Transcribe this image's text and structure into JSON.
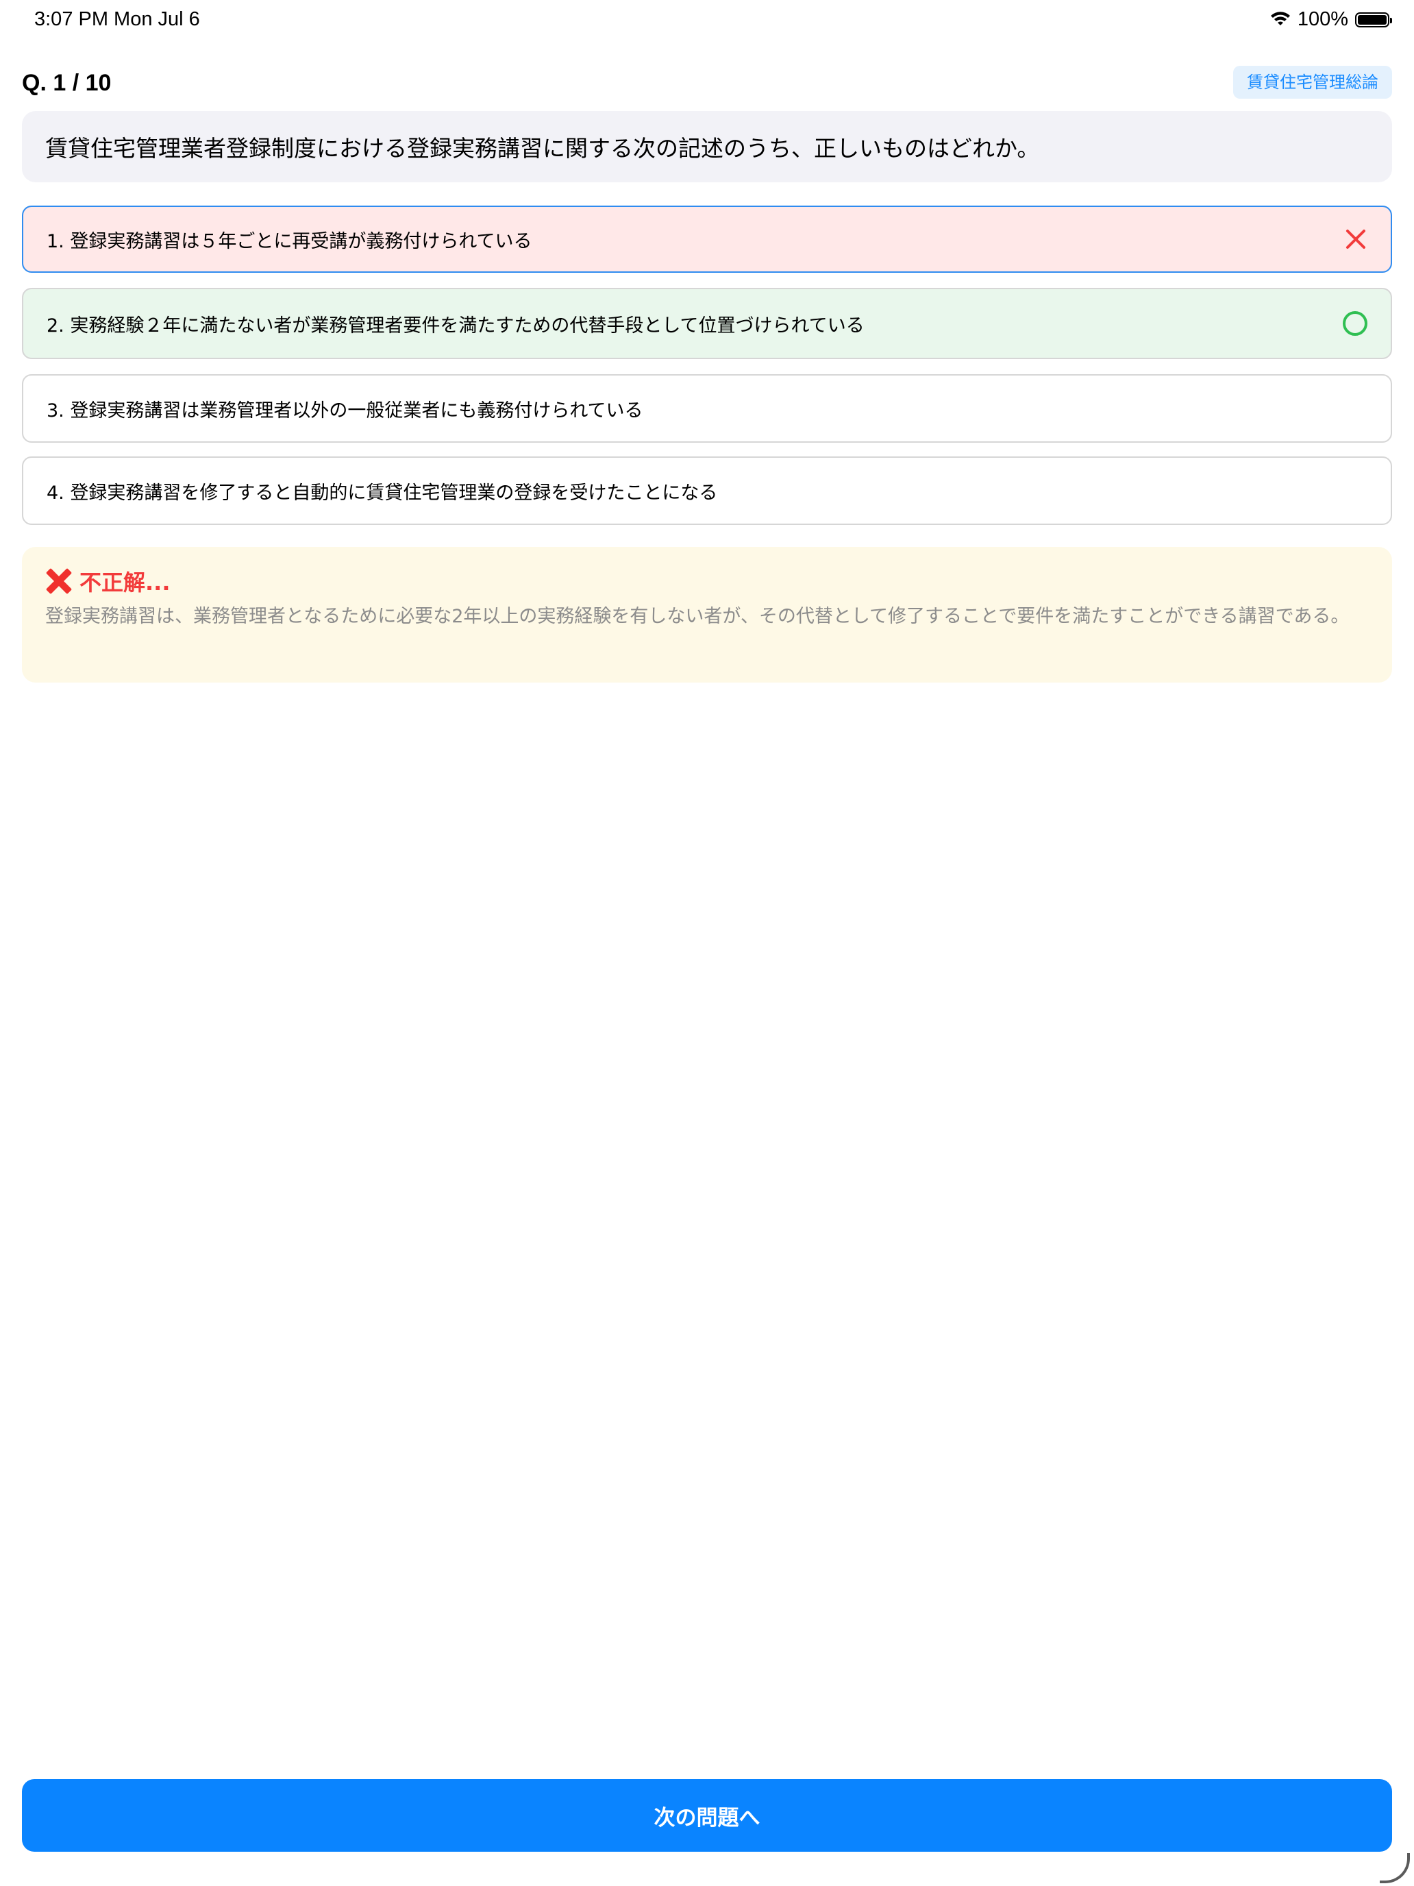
{
  "status_bar": {
    "time_date": "3:07 PM   Mon Jul 6",
    "battery_percent": "100%",
    "battery_level": 1.0
  },
  "header": {
    "question_number": "Q. 1 / 10",
    "category": "賃貸住宅管理総論"
  },
  "question": {
    "text": "賃貸住宅管理業者登録制度における登録実務講習に関する次の記述のうち、正しいものはどれか。"
  },
  "choices": [
    {
      "label": "1. 登録実務講習は５年ごとに再受講が義務付けられている",
      "state": "wrong"
    },
    {
      "label": "2. 実務経験２年に満たない者が業務管理者要件を満たすための代替手段として位置づけられている",
      "state": "correct"
    },
    {
      "label": "3. 登録実務講習は業務管理者以外の一般従業者にも義務付けられている",
      "state": "none"
    },
    {
      "label": "4. 登録実務講習を修了すると自動的に賃貸住宅管理業の登録を受けたことになる",
      "state": "none"
    }
  ],
  "feedback": {
    "title": "不正解...",
    "explanation": "登録実務講習は、業務管理者となるために必要な2年以上の実務経験を有しない者が、その代替として修了することで要件を満たすことができる講習である。"
  },
  "actions": {
    "next_label": "次の問題へ"
  },
  "colors": {
    "accent": "#0a84ff",
    "wrong": "#f23b3b",
    "correct": "#2fbf52",
    "feedback_bg": "#fef9e6"
  }
}
